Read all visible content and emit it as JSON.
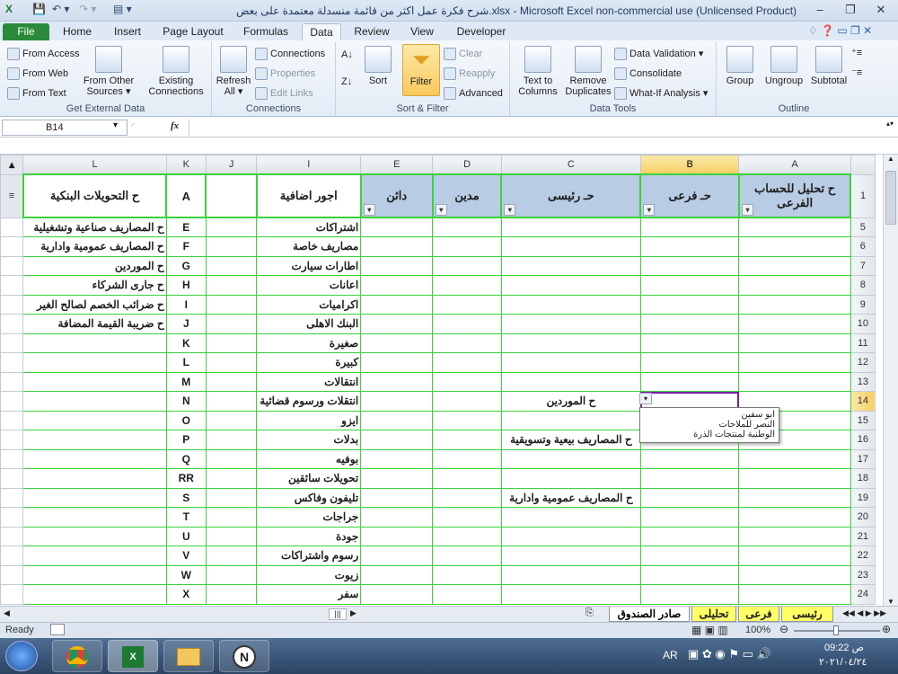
{
  "window": {
    "title": "شرح فكرة عمل اكثر من قائمة منسدلة معتمدة على بعض.xlsx - Microsoft Excel non-commercial use (Unlicensed Product)"
  },
  "tabs": [
    "File",
    "Home",
    "Insert",
    "Page Layout",
    "Formulas",
    "Data",
    "Review",
    "View",
    "Developer"
  ],
  "ribbon": {
    "get_external": {
      "name": "Get External Data",
      "from_access": "From Access",
      "from_web": "From Web",
      "from_text": "From Text",
      "from_other": "From Other",
      "sources": "Sources ▾",
      "existing": "Existing",
      "connections": "Connections"
    },
    "connections": {
      "name": "Connections",
      "refresh": "Refresh",
      "all": "All ▾",
      "conn": "Connections",
      "props": "Properties",
      "edit": "Edit Links"
    },
    "sort": {
      "name": "Sort & Filter",
      "az": "A↓Z",
      "sort": "Sort",
      "filter": "Filter",
      "clear": "Clear",
      "reapply": "Reapply",
      "advanced": "Advanced"
    },
    "tools": {
      "name": "Data Tools",
      "ttc1": "Text to",
      "ttc2": "Columns",
      "rd1": "Remove",
      "rd2": "Duplicates",
      "dv": "Data Validation ▾",
      "consolidate": "Consolidate",
      "whatif": "What-If Analysis ▾"
    },
    "outline": {
      "name": "Outline",
      "group": "Group",
      "ungroup": "Ungroup",
      "subtotal": "Subtotal"
    }
  },
  "formula_bar": {
    "name_box": "B14",
    "fx": "fx",
    "value": ""
  },
  "columns": [
    "L",
    "K",
    "J",
    "I",
    "E",
    "D",
    "C",
    "B",
    "A"
  ],
  "headers": {
    "L": "ح التحويلات البنكية",
    "K": "A",
    "J": "",
    "I": "اجور اضافية",
    "E": "دائن",
    "D": "مدين",
    "C": "حـ رئيسى",
    "B": "حـ فرعى",
    "A": "ح تحليل للحساب الفرعى"
  },
  "rows": [
    {
      "n": "5",
      "L": "ح المصاريف صناعية وتشغيلية",
      "K": "E",
      "I": "اشتراكات",
      "C": ""
    },
    {
      "n": "6",
      "L": "ح المصاريف عمومية وادارية",
      "K": "F",
      "I": "مصاريف خاصة",
      "C": ""
    },
    {
      "n": "7",
      "L": "ح الموردين",
      "K": "G",
      "I": "اطارات سيارت",
      "C": ""
    },
    {
      "n": "8",
      "L": "ح جارى الشركاء",
      "K": "H",
      "I": "اعانات",
      "C": ""
    },
    {
      "n": "9",
      "L": "ح ضرائب الخصم لصالح الغير",
      "K": "I",
      "I": "اكراميات",
      "C": ""
    },
    {
      "n": "10",
      "L": "ح ضريبة القيمة المضافة",
      "K": "J",
      "I": "البنك الاهلى",
      "C": ""
    },
    {
      "n": "11",
      "L": "",
      "K": "K",
      "I": "صغيرة",
      "C": ""
    },
    {
      "n": "12",
      "L": "",
      "K": "L",
      "I": "كبيرة",
      "C": ""
    },
    {
      "n": "13",
      "L": "",
      "K": "M",
      "I": "انتقالات",
      "C": ""
    },
    {
      "n": "14",
      "L": "",
      "K": "N",
      "I": "انتقلات ورسوم قضائية",
      "C": "ح الموردين"
    },
    {
      "n": "15",
      "L": "",
      "K": "O",
      "I": "ايزو",
      "C": ""
    },
    {
      "n": "16",
      "L": "",
      "K": "P",
      "I": "بدلات",
      "C": "ح المصاريف بيعية وتسويقية"
    },
    {
      "n": "17",
      "L": "",
      "K": "Q",
      "I": "بوفيه",
      "C": ""
    },
    {
      "n": "18",
      "L": "",
      "K": "RR",
      "I": "تحويلات سائقين",
      "C": ""
    },
    {
      "n": "19",
      "L": "",
      "K": "S",
      "I": "تليفون وفاكس",
      "C": "ح المصاريف عمومية وادارية"
    },
    {
      "n": "20",
      "L": "",
      "K": "T",
      "I": "جراجات",
      "C": ""
    },
    {
      "n": "21",
      "L": "",
      "K": "U",
      "I": "جودة",
      "C": ""
    },
    {
      "n": "22",
      "L": "",
      "K": "V",
      "I": "رسوم واشتراكات",
      "C": ""
    },
    {
      "n": "23",
      "L": "",
      "K": "W",
      "I": "زيوت",
      "C": ""
    },
    {
      "n": "24",
      "L": "",
      "K": "X",
      "I": "سفر",
      "C": ""
    }
  ],
  "dropdown": [
    "ابو سفين",
    "النصر للملاحات",
    "الوطنية لمنتجات الذرة"
  ],
  "sheet_tabs": [
    "صادر الصندوق",
    "تحليلى",
    "فرعى",
    "رئيسى"
  ],
  "status": {
    "ready": "Ready",
    "zoom": "100%"
  },
  "taskbar": {
    "lang": "AR",
    "time": "ص 09:22",
    "date": "٢٠٢١/٠٤/٢٤"
  },
  "colors": {
    "grid": "#3ad23a",
    "header_fill": "#b8cce4",
    "tab_fill": "#ffff66",
    "file_tab": "#2a8a3a"
  }
}
